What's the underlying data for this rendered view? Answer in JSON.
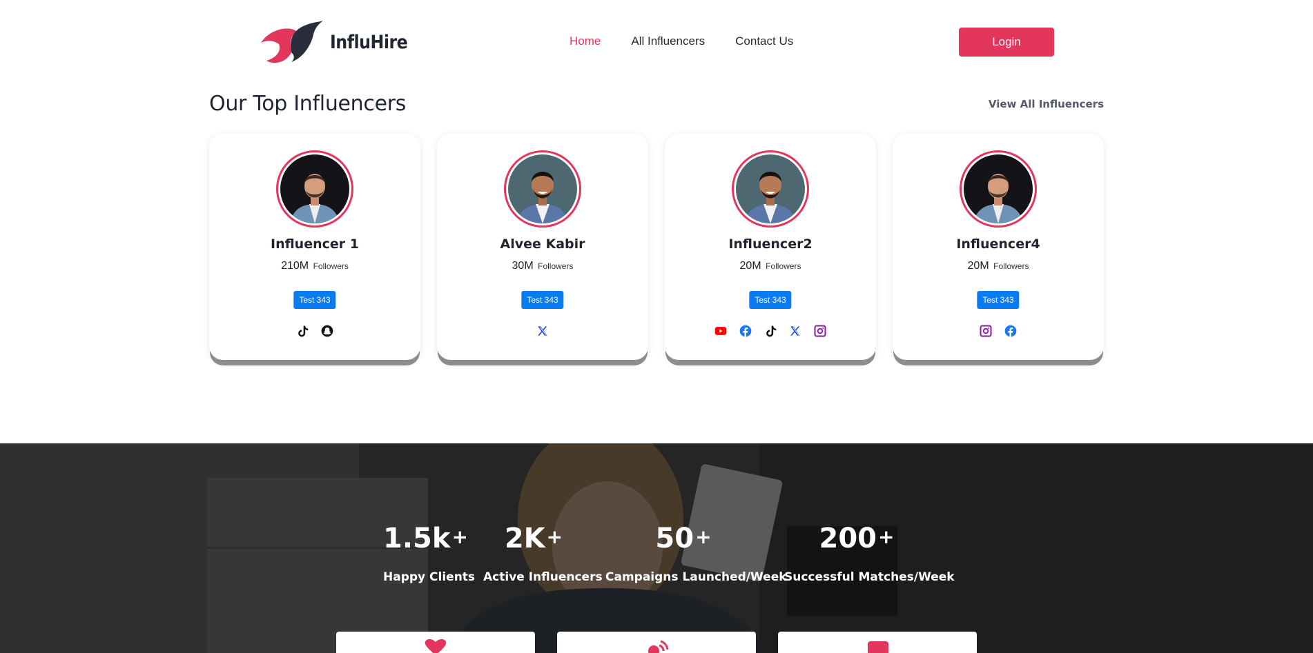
{
  "header": {
    "brand": "InfluHire",
    "nav": [
      {
        "label": "Home",
        "active": true
      },
      {
        "label": "All Influencers",
        "active": false
      },
      {
        "label": "Contact Us",
        "active": false
      }
    ],
    "login_label": "Login"
  },
  "top": {
    "title": "Our Top Influencers",
    "view_all": "View All Influencers"
  },
  "cards": [
    {
      "name": "Influencer 1",
      "followers": "210M",
      "followers_label": "Followers",
      "tag": "Test 343",
      "socials": [
        "tiktok-icon",
        "snapchat-icon"
      ]
    },
    {
      "name": "Alvee Kabir",
      "followers": "30M",
      "followers_label": "Followers",
      "tag": "Test 343",
      "socials": [
        "x-icon"
      ]
    },
    {
      "name": "Influencer2",
      "followers": "20M",
      "followers_label": "Followers",
      "tag": "Test 343",
      "socials": [
        "youtube-icon",
        "facebook-icon",
        "tiktok-icon",
        "x-icon",
        "instagram-icon"
      ]
    },
    {
      "name": "Influencer4",
      "followers": "20M",
      "followers_label": "Followers",
      "tag": "Test 343",
      "socials": [
        "instagram-icon",
        "facebook-icon"
      ]
    }
  ],
  "stats": [
    {
      "value": "1.5k",
      "suffix": "+",
      "label": "Happy Clients"
    },
    {
      "value": "2K",
      "suffix": "+",
      "label": "Active Influencers"
    },
    {
      "value": "50",
      "suffix": "+",
      "label": "Campaigns Launched/Week"
    },
    {
      "value": "200",
      "suffix": "+",
      "label": "Successful Matches/Week"
    }
  ],
  "colors": {
    "accent": "#e2365c",
    "tag": "#0a7cf2",
    "youtube": "#ff0000",
    "facebook": "#1877f2",
    "x": "#1d3fd9",
    "instagram": "#8a1a9c"
  }
}
